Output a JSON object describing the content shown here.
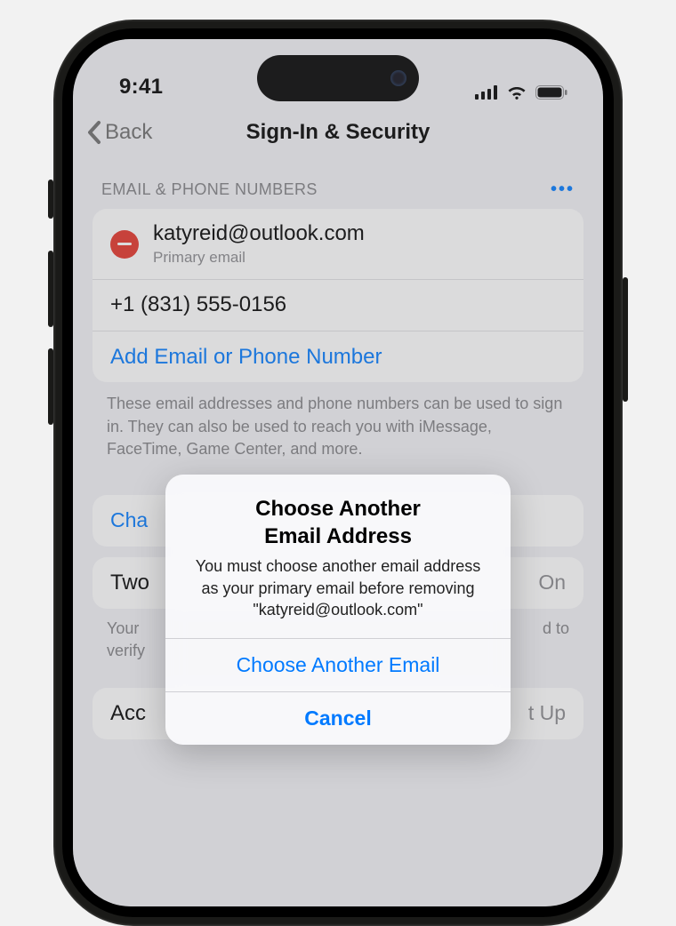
{
  "status_bar": {
    "time": "9:41"
  },
  "nav": {
    "back_label": "Back",
    "title": "Sign-In & Security"
  },
  "section": {
    "header": "EMAIL & PHONE NUMBERS",
    "primary_email": "katyreid@outlook.com",
    "primary_email_sub": "Primary email",
    "phone": "+1 (831) 555-0156",
    "add_label": "Add Email or Phone Number",
    "footer": "These email addresses and phone numbers can be used to sign in. They can also be used to reach you with iMessage, FaceTime, Game Center, and more."
  },
  "rows": {
    "change_prefix": "Cha",
    "twofactor_prefix": "Two",
    "twofactor_value": "On",
    "verify_footer_prefix": "Your",
    "verify_footer_suffix": "d to",
    "verify_footer_line2": "verify",
    "account_prefix": "Acc",
    "account_value_suffix": "t Up"
  },
  "alert": {
    "title_line1": "Choose Another",
    "title_line2": "Email Address",
    "message": "You must choose another email address as your primary email before removing \"katyreid@outlook.com\"",
    "primary_action": "Choose Another Email",
    "cancel": "Cancel"
  },
  "colors": {
    "link": "#007aff",
    "danger": "#e53328"
  }
}
